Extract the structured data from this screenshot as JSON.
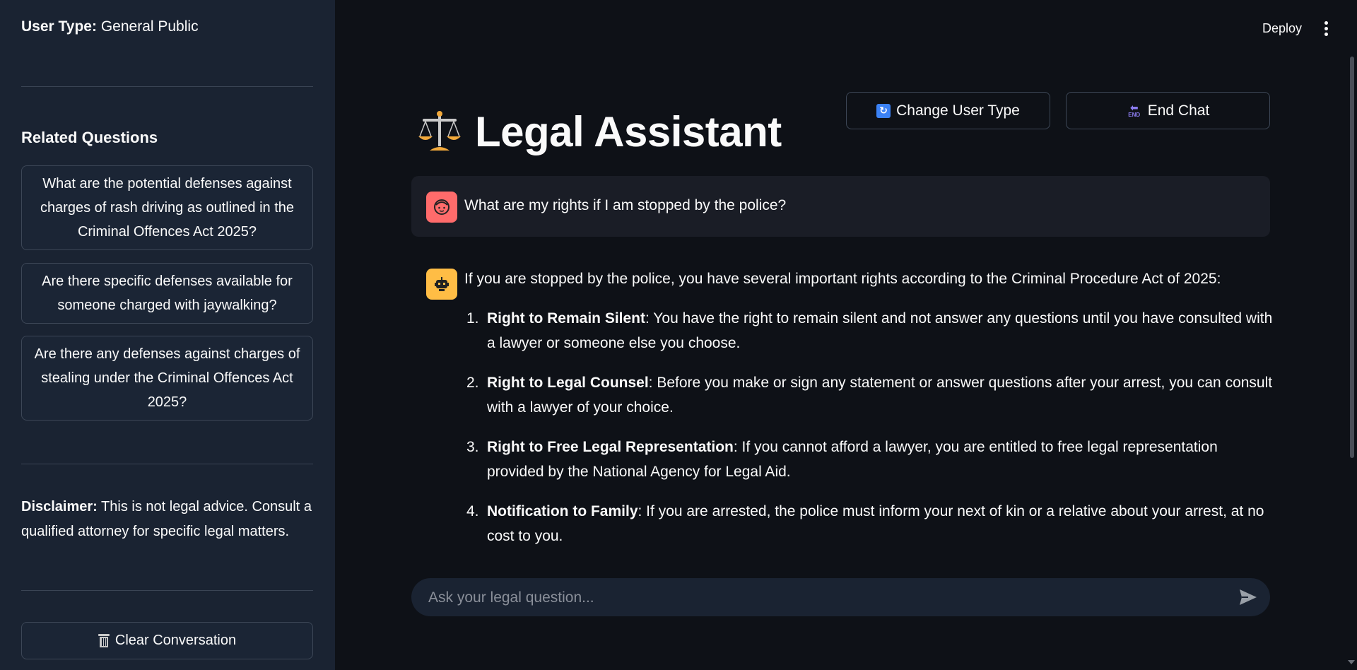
{
  "sidebar": {
    "user_type_label": "User Type:",
    "user_type_value": "General Public",
    "related_title": "Related Questions",
    "related_questions": [
      "What are the potential defenses against charges of rash driving as outlined in the Criminal Offences Act 2025?",
      "Are there specific defenses available for someone charged with jaywalking?",
      "Are there any defenses against charges of stealing under the Criminal Offences Act 2025?"
    ],
    "disclaimer_label": "Disclaimer:",
    "disclaimer_text": "This is not legal advice. Consult a qualified attorney for specific legal matters.",
    "clear_label": "Clear Conversation"
  },
  "header": {
    "deploy_label": "Deploy"
  },
  "main": {
    "change_user_label": "Change User Type",
    "end_chat_label": "End Chat",
    "title": "Legal Assistant",
    "user_message": "What are my rights if I am stopped by the police?",
    "bot_intro": "If you are stopped by the police, you have several important rights according to the Criminal Procedure Act of 2025:",
    "rights": [
      {
        "num": "1.",
        "term": "Right to Remain Silent",
        "text": ": You have the right to remain silent and not answer any questions until you have consulted with a lawyer or someone else you choose."
      },
      {
        "num": "2.",
        "term": "Right to Legal Counsel",
        "text": ": Before you make or sign any statement or answer questions after your arrest, you can consult with a lawyer of your choice."
      },
      {
        "num": "3.",
        "term": "Right to Free Legal Representation",
        "text": ": If you cannot afford a lawyer, you are entitled to free legal representation provided by the National Agency for Legal Aid."
      },
      {
        "num": "4.",
        "term": "Notification to Family",
        "text": ": If you are arrested, the police must inform your next of kin or a relative about your arrest, at no cost to you."
      }
    ],
    "input_placeholder": "Ask your legal question..."
  },
  "colors": {
    "background": "#0e1117",
    "sidebar": "#1a2332",
    "user_avatar": "#ff6b6b",
    "bot_avatar": "#ffbd45"
  },
  "icons": [
    "scales-icon",
    "refresh-icon",
    "end-icon",
    "user-face-icon",
    "robot-icon",
    "trash-icon",
    "send-icon",
    "menu-icon"
  ]
}
